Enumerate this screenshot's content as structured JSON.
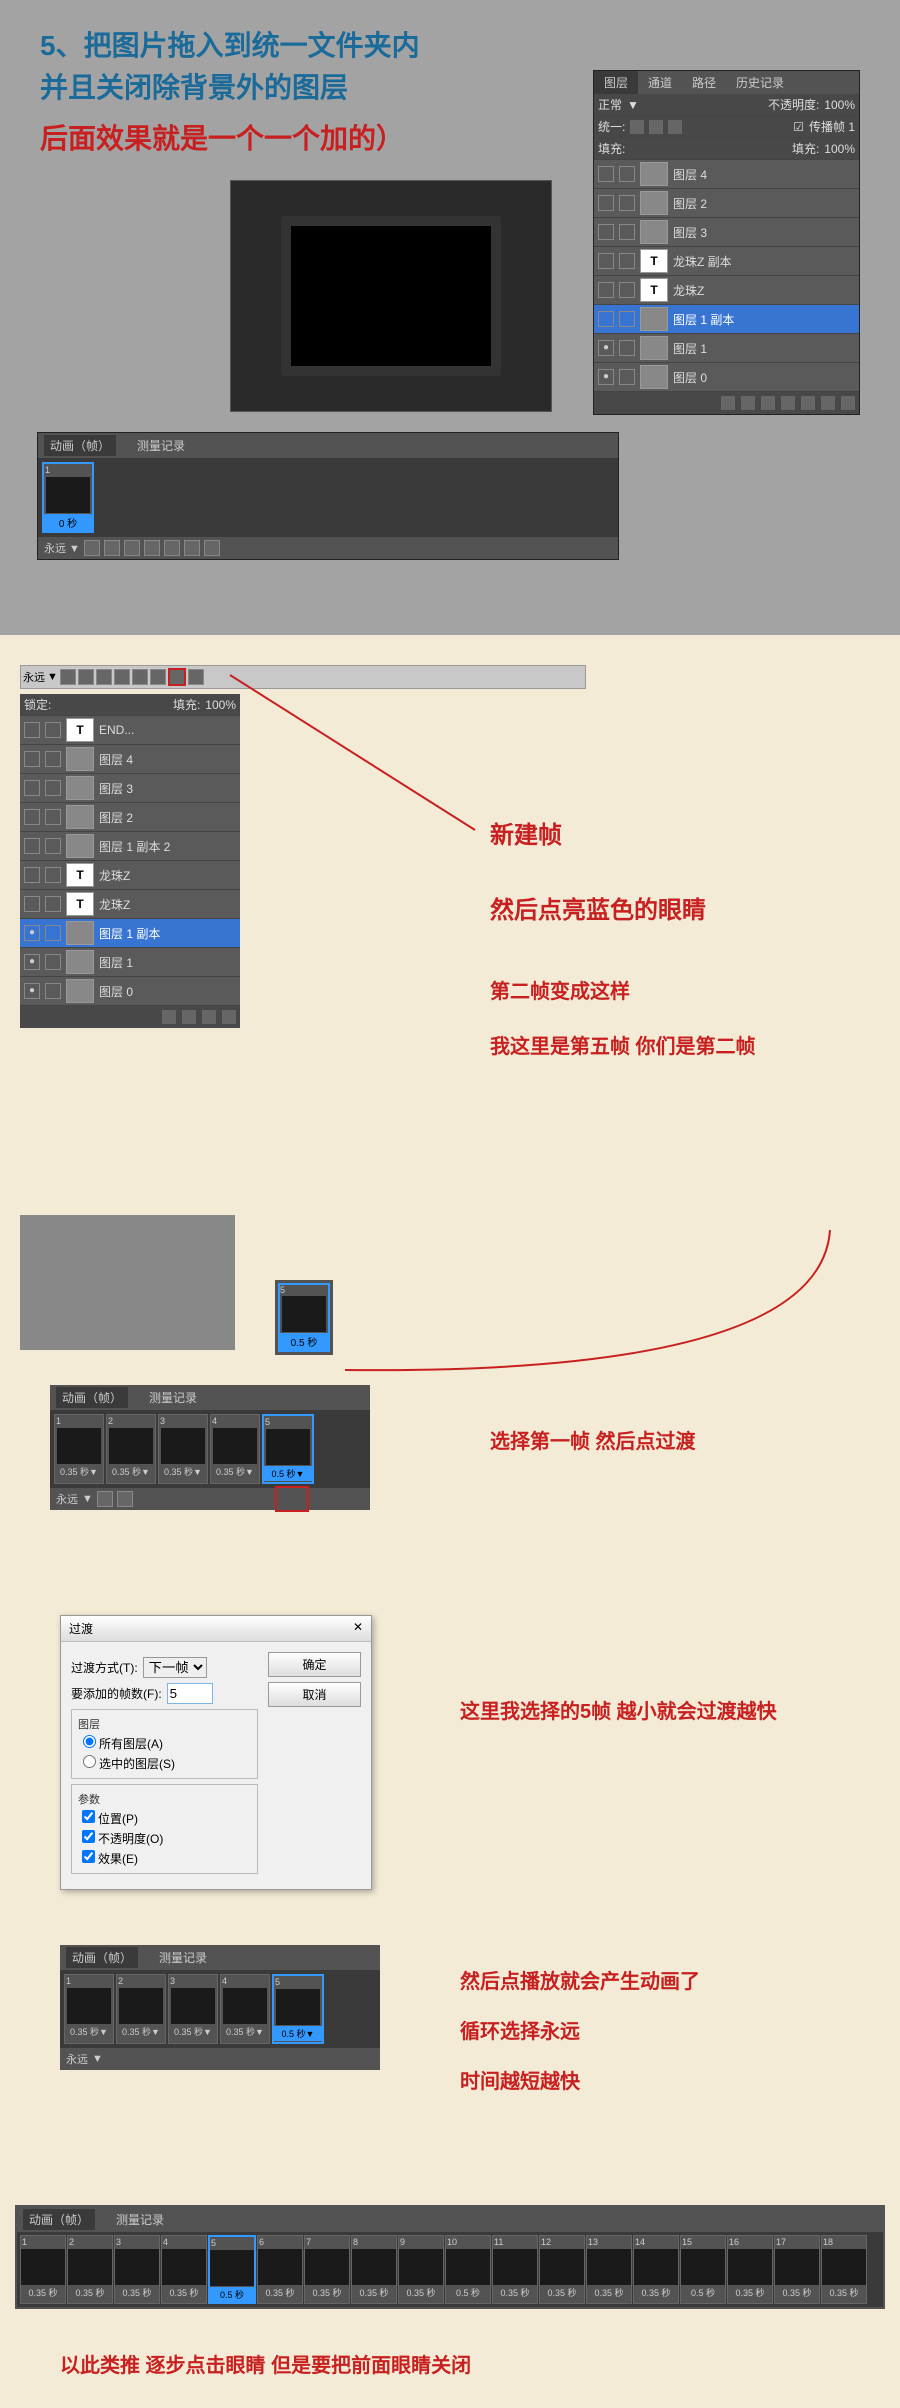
{
  "top": {
    "title1": "5、把图片拖入到统一文件夹内",
    "title2": "并且关闭除背景外的图层",
    "title3": "后面效果就是一个一个加的）",
    "anim_tab1": "动画（帧）",
    "anim_tab2": "测量记录",
    "frame_time": "0 秒",
    "loop": "永远 ▼",
    "layers_tabs": [
      "图层",
      "通道",
      "路径",
      "历史记录"
    ],
    "mode": "正常",
    "opacity_label": "不透明度:",
    "opacity": "100%",
    "unify": "统一:",
    "propagate": "传播帧 1",
    "fill_label": "填充:",
    "fill": "100%",
    "layers": [
      {
        "eye": false,
        "type": "img",
        "name": "图层 4"
      },
      {
        "eye": false,
        "type": "img",
        "name": "图层 2"
      },
      {
        "eye": false,
        "type": "img",
        "name": "图层 3"
      },
      {
        "eye": false,
        "type": "T",
        "name": "龙珠Z 副本"
      },
      {
        "eye": false,
        "type": "T",
        "name": "龙珠Z"
      },
      {
        "eye": false,
        "type": "img",
        "name": "图层 1 副本",
        "sel": true
      },
      {
        "eye": true,
        "type": "img",
        "name": "图层 1"
      },
      {
        "eye": true,
        "type": "img",
        "name": "图层 0"
      }
    ]
  },
  "sec2": {
    "loop": "永远",
    "fill_label": "填充:",
    "fill": "100%",
    "lock": "锁定:",
    "layers": [
      {
        "eye": false,
        "type": "T",
        "name": "END..."
      },
      {
        "eye": false,
        "type": "img",
        "name": "图层 4"
      },
      {
        "eye": false,
        "type": "img",
        "name": "图层 3"
      },
      {
        "eye": false,
        "type": "img",
        "name": "图层 2"
      },
      {
        "eye": false,
        "type": "img",
        "name": "图层 1 副本 2"
      },
      {
        "eye": false,
        "type": "T",
        "name": "龙珠Z"
      },
      {
        "eye": false,
        "type": "T",
        "name": "龙珠Z"
      },
      {
        "eye": true,
        "type": "img",
        "name": "图层 1 副本",
        "sel": true
      },
      {
        "eye": true,
        "type": "img",
        "name": "图层 1"
      },
      {
        "eye": true,
        "type": "img",
        "name": "图层 0"
      }
    ],
    "note1": "新建帧",
    "note2": "然后点亮蓝色的眼睛",
    "note3": "第二帧变成这样",
    "note4": "我这里是第五帧 你们是第二帧"
  },
  "sec3": {
    "frame5": "5",
    "frame5_time": "0.5 秒",
    "frames": [
      {
        "n": "1",
        "t": "0.35 秒▼"
      },
      {
        "n": "2",
        "t": "0.35 秒▼"
      },
      {
        "n": "3",
        "t": "0.35 秒▼"
      },
      {
        "n": "4",
        "t": "0.35 秒▼"
      },
      {
        "n": "5",
        "t": "0.5 秒▼",
        "sel": true
      }
    ],
    "loop": "永远",
    "note": "选择第一帧  然后点过渡"
  },
  "dialog": {
    "title": "过渡",
    "close": "✕",
    "method_label": "过渡方式(T):",
    "method": "下一帧",
    "frames_label": "要添加的帧数(F):",
    "frames": "5",
    "group1": "图层",
    "r1": "所有图层(A)",
    "r2": "选中的图层(S)",
    "group2": "参数",
    "c1": "位置(P)",
    "c2": "不透明度(O)",
    "c3": "效果(E)",
    "ok": "确定",
    "cancel": "取消",
    "note": "这里我选择的5帧  越小就会过渡越快"
  },
  "sec5": {
    "frames": [
      {
        "n": "1",
        "t": "0.35 秒▼"
      },
      {
        "n": "2",
        "t": "0.35 秒▼"
      },
      {
        "n": "3",
        "t": "0.35 秒▼"
      },
      {
        "n": "4",
        "t": "0.35 秒▼"
      },
      {
        "n": "5",
        "t": "0.5 秒▼",
        "sel": true
      }
    ],
    "loop": "永远",
    "note1": "然后点播放就会产生动画了",
    "note2": "循环选择永远",
    "note3": "时间越短越快"
  },
  "strip": {
    "frames": [
      {
        "n": "1",
        "t": "0.35 秒"
      },
      {
        "n": "2",
        "t": "0.35 秒"
      },
      {
        "n": "3",
        "t": "0.35 秒"
      },
      {
        "n": "4",
        "t": "0.35 秒"
      },
      {
        "n": "5",
        "t": "0.5 秒",
        "sel": true
      },
      {
        "n": "6",
        "t": "0.35 秒"
      },
      {
        "n": "7",
        "t": "0.35 秒"
      },
      {
        "n": "8",
        "t": "0.35 秒"
      },
      {
        "n": "9",
        "t": "0.35 秒"
      },
      {
        "n": "10",
        "t": "0.5 秒"
      },
      {
        "n": "11",
        "t": "0.35 秒"
      },
      {
        "n": "12",
        "t": "0.35 秒"
      },
      {
        "n": "13",
        "t": "0.35 秒"
      },
      {
        "n": "14",
        "t": "0.35 秒"
      },
      {
        "n": "15",
        "t": "0.5 秒"
      },
      {
        "n": "16",
        "t": "0.35 秒"
      },
      {
        "n": "17",
        "t": "0.35 秒"
      },
      {
        "n": "18",
        "t": "0.35 秒"
      }
    ]
  },
  "final": "以此类推 逐步点击眼睛 但是要把前面眼睛关闭"
}
